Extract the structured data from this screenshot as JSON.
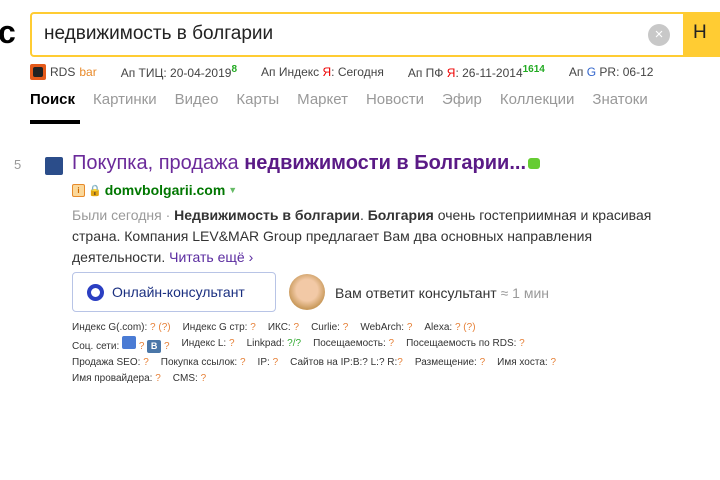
{
  "header": {
    "logo": "с",
    "query": "недвижимость в болгарии",
    "search_button": "Н"
  },
  "toolbar": {
    "rds": "RDS",
    "rds_bar": "bar",
    "tic_label": "Ап ТИЦ:",
    "tic_date": "20-04-2019",
    "tic_value": "8",
    "index_label": "Ап Индекс",
    "index_y": "Я",
    "index_value": "Сегодня",
    "pf_label": "Ап ПФ",
    "pf_y": "Я",
    "pf_date": "26-11-2014",
    "pf_value": "1614",
    "pr_label": "Ап",
    "pr_g": "G",
    "pr_text": "PR: 06-12"
  },
  "tabs": [
    "Поиск",
    "Картинки",
    "Видео",
    "Карты",
    "Маркет",
    "Новости",
    "Эфир",
    "Коллекции",
    "Знатоки"
  ],
  "result": {
    "number": "5",
    "title_plain": "Покупка, продажа ",
    "title_bold": "недвижимости в Болгарии...",
    "url": "domvbolgarii.com",
    "visited": "Были сегодня · ",
    "snippet_b1": "Недвижимость в болгарии",
    "snippet_t1": ". ",
    "snippet_b2": "Болгария",
    "snippet_t2": " очень гостеприимная и красивая страна. Компания LEV&MAR Group предлагает Вам два основных направления деятельности. ",
    "more": "Читать ещё ›",
    "consult_button": "Онлайн-консультант",
    "answer": "Вам ответит консультант",
    "answer_time": " ≈ 1 мин"
  },
  "meta": [
    [
      {
        "l": "Индекс G(.com):",
        "v": "? (?)"
      },
      {
        "l": "Индекс G стр:",
        "v": "?"
      },
      {
        "l": "ИКС:",
        "v": "?"
      },
      {
        "l": "Curlie:",
        "v": "?"
      },
      {
        "l": "WebArch:",
        "v": "?"
      },
      {
        "l": "Alexa:",
        "v": "? (?)"
      }
    ],
    [
      {
        "l": "Соц. сети:",
        "v": "?"
      },
      {
        "l": "Индекс L:",
        "v": "?"
      },
      {
        "l": "Linkpad:",
        "v": "?/?"
      },
      {
        "l": "Посещаемость:",
        "v": "?"
      },
      {
        "l": "Посещаемость по RDS:",
        "v": "?"
      }
    ],
    [
      {
        "l": "Продажа SEO:",
        "v": "?"
      },
      {
        "l": "Покупка ссылок:",
        "v": "?"
      },
      {
        "l": "IP:",
        "v": "?"
      },
      {
        "l": "Сайтов на IP:B:? L:? R:",
        "v": "?"
      },
      {
        "l": "Размещение:",
        "v": "?"
      },
      {
        "l": "Имя хоста:",
        "v": "?"
      }
    ],
    [
      {
        "l": "Имя провайдера:",
        "v": "?"
      },
      {
        "l": "CMS:",
        "v": "?"
      }
    ]
  ],
  "social_vk": "B",
  "social_q": "?"
}
